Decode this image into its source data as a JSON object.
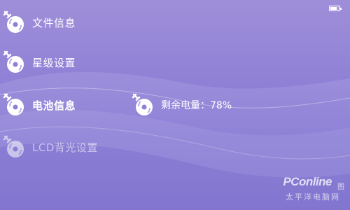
{
  "status": {
    "battery_level": 0.78,
    "battery_icon": "battery-icon"
  },
  "menu": {
    "items": [
      {
        "label": "文件信息",
        "icon": "disc-wrench-icon"
      },
      {
        "label": "星级设置",
        "icon": "disc-wrench-icon"
      },
      {
        "label": "电池信息",
        "icon": "disc-wrench-icon"
      },
      {
        "label": "LCD背光设置",
        "icon": "disc-wrench-icon"
      }
    ],
    "selected_index": 2
  },
  "detail": {
    "text": "剩余电量：78%",
    "icon": "disc-wrench-icon"
  },
  "watermark": {
    "logo": "PConline",
    "subtitle": "太平洋电脑网",
    "tag": "图"
  },
  "colors": {
    "background_top": "#9f8fd9",
    "background_bottom": "#7466cd",
    "text": "#ffffff"
  }
}
